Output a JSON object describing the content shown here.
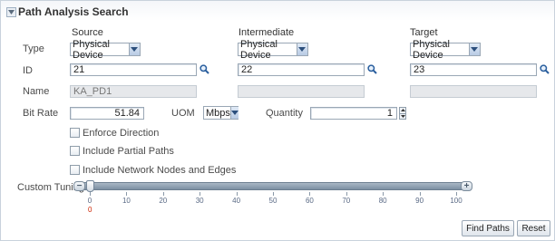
{
  "panel": {
    "title": "Path Analysis Search"
  },
  "columns": {
    "source": "Source",
    "intermediate": "Intermediate",
    "target": "Target"
  },
  "labels": {
    "type": "Type",
    "id": "ID",
    "name": "Name",
    "bit_rate": "Bit Rate",
    "uom": "UOM",
    "quantity": "Quantity",
    "custom_tuning": "Custom Tuning"
  },
  "source": {
    "type": "Physical Device",
    "id": "21",
    "name": "KA_PD1"
  },
  "intermediate": {
    "type": "Physical Device",
    "id": "22",
    "name": ""
  },
  "target": {
    "type": "Physical Device",
    "id": "23",
    "name": ""
  },
  "bit_rate": "51.84",
  "uom": "Mbps",
  "quantity": "1",
  "options": {
    "enforce_direction": {
      "label": "Enforce Direction",
      "checked": false
    },
    "include_partial_paths": {
      "label": "Include Partial Paths",
      "checked": false
    },
    "include_network_nodes": {
      "label": "Include Network Nodes and Edges",
      "checked": false
    }
  },
  "slider": {
    "value": 0,
    "value_label": "0",
    "min": 0,
    "max": 100,
    "ticks": [
      "0",
      "10",
      "20",
      "30",
      "40",
      "50",
      "60",
      "70",
      "80",
      "90",
      "100"
    ]
  },
  "buttons": {
    "find_paths": "Find Paths",
    "reset": "Reset"
  },
  "colors": {
    "accent_value": "#cc2200",
    "tick_label": "#5a6a85",
    "search_icon": "#2b5f9e"
  }
}
